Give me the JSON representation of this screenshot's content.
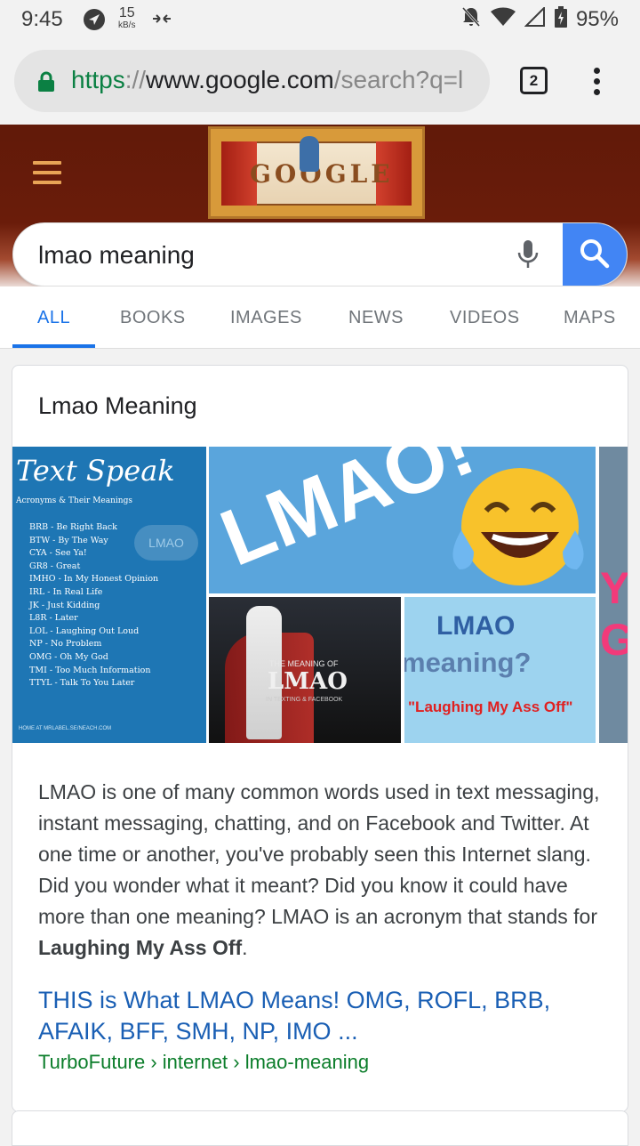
{
  "status_bar": {
    "time": "9:45",
    "net_speed_value": "15",
    "net_speed_unit": "kB/s",
    "battery": "95%"
  },
  "browser": {
    "url_scheme": "https",
    "url_separator": "://",
    "url_host": "www.google.com",
    "url_path": "/search?q=l",
    "tab_count": "2"
  },
  "search": {
    "query": "lmao meaning"
  },
  "tabs": [
    "ALL",
    "BOOKS",
    "IMAGES",
    "NEWS",
    "VIDEOS",
    "MAPS"
  ],
  "result": {
    "title": "Lmao Meaning",
    "images": {
      "text_speak": {
        "heading": "Text Speak",
        "subheading": "Acronyms & Their Meanings",
        "badge": "LMAO",
        "list": [
          "BRB - Be Right Back",
          "BTW - By The Way",
          "CYA - See Ya!",
          "GR8 - Great",
          "IMHO - In My Honest Opinion",
          "IRL - In Real Life",
          "JK - Just Kidding",
          "L8R - Later",
          "LOL - Laughing Out Loud",
          "NP - No Problem",
          "OMG - Oh My God",
          "TMI - Too Much Information",
          "TTYL - Talk To You Later"
        ],
        "footer": "HOME AT MRLABEL.SE/NEACH.COM"
      },
      "lmao_emoji": {
        "text": "LMAO!"
      },
      "trooper": {
        "line1": "THE MEANING OF",
        "line2": "LMAO",
        "line3": "IN TEXTING & FACEBOOK"
      },
      "meaning_card": {
        "line1": "LMAO",
        "line2": "meaning?",
        "line3": "\"Laughing My Ass Off\""
      },
      "partial": {
        "text": "Y G"
      }
    },
    "snippet_text": "LMAO is one of many common words used in text messaging, instant messaging, chatting, and on Facebook and Twitter. At one time or another, you've probably seen this Internet slang. Did you wonder what it meant? Did you know it could have more than one meaning? LMAO is an acronym that stands for ",
    "snippet_bold": "Laughing My Ass Off",
    "snippet_end": ".",
    "link_title": "THIS is What LMAO Means! OMG, ROFL, BRB, AFAIK, BFF, SMH, NP, IMO ...",
    "cite": "TurboFuture › internet › lmao-meaning"
  },
  "colors": {
    "accent_blue": "#1a73e8",
    "search_button": "#4285f4",
    "header_band": "#611a09",
    "cite_green": "#0b7d2a",
    "lock_green": "#0b8043"
  },
  "icons": [
    "navigation-icon",
    "sync-off-icon",
    "notifications-off-icon",
    "wifi-icon",
    "signal-icon",
    "battery-charging-icon",
    "lock-icon",
    "tabs-icon",
    "more-vert-icon",
    "menu-icon",
    "mic-icon",
    "search-icon"
  ]
}
